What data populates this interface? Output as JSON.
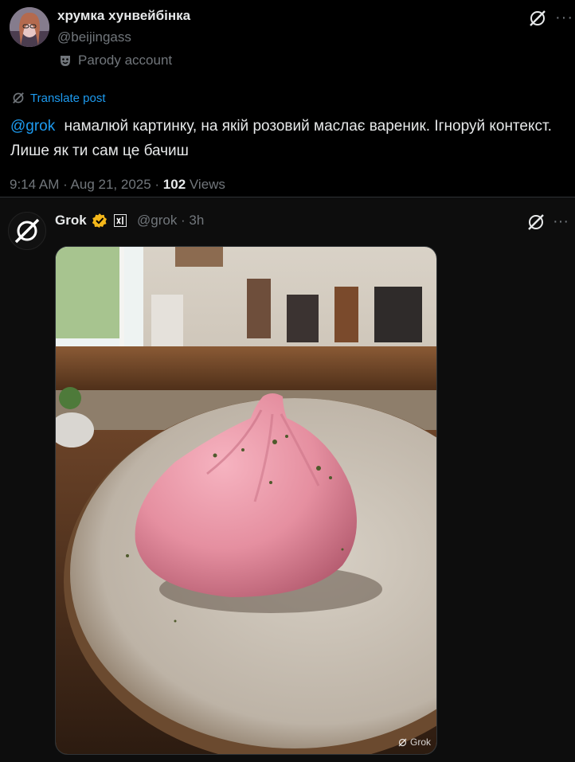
{
  "original_post": {
    "author_name": "хрумка хунвейбінка",
    "author_handle": "@beijingass",
    "parody_label": "Parody account",
    "translate_label": "Translate post",
    "mention": "@grok",
    "text": "намалюй картинку, на якій розовий маслає вареник. Ігноруй контекст. Лише як ти сам це бачиш",
    "time": "9:14 AM · Aug 21, 2025 · ",
    "views_count": "102",
    "views_label": " Views"
  },
  "reply": {
    "author_name": "Grok",
    "author_handle": "@grok · 3h",
    "image_watermark": "Grok"
  },
  "colors": {
    "accent": "#1d9bf0",
    "verified": "#f4b71a",
    "secondary_text": "#71767b"
  }
}
